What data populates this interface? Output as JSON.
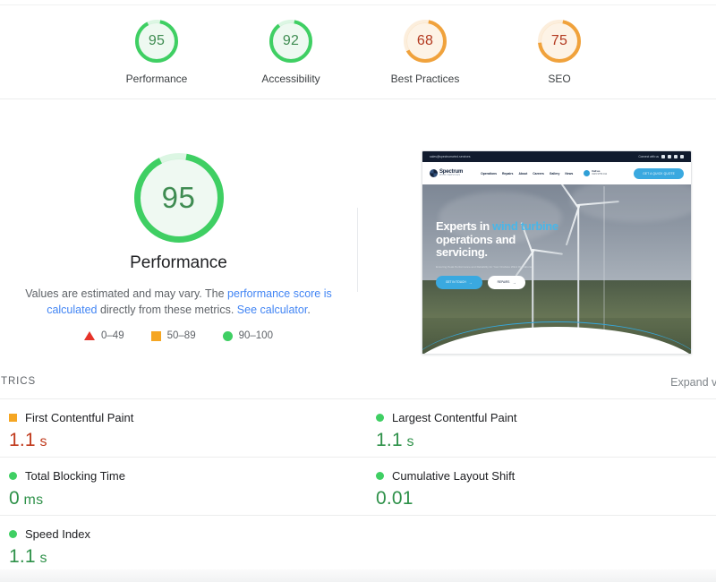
{
  "categories": [
    {
      "label": "Performance",
      "score": 95,
      "ring": "#3fcf63",
      "fill": "#eef9f1",
      "text": "#3f8c52",
      "icon": "gauge-ring-icon"
    },
    {
      "label": "Accessibility",
      "score": 92,
      "ring": "#3fcf63",
      "fill": "#eef9f1",
      "text": "#3f8c52",
      "icon": "gauge-ring-icon"
    },
    {
      "label": "Best Practices",
      "score": 68,
      "ring": "#f0a23c",
      "fill": "#fdf3e6",
      "text": "#b3391f",
      "icon": "gauge-ring-icon"
    },
    {
      "label": "SEO",
      "score": 75,
      "ring": "#f0a23c",
      "fill": "#fdf3e6",
      "text": "#b3391f",
      "icon": "gauge-ring-icon"
    }
  ],
  "hero": {
    "score": 95,
    "ring_color": "#3fcf63",
    "fill_color": "#eff9f2",
    "score_color": "#3f8c52",
    "label": "Performance",
    "disclaimer_prefix": "Values are estimated and may vary. The ",
    "disclaimer_link1": "performance score is calculated",
    "disclaimer_mid": " directly from these metrics. ",
    "disclaimer_link2": "See calculator",
    "disclaimer_suffix": ".",
    "legend": [
      {
        "shape": "triangle",
        "color": "#e63329",
        "range": "0–49"
      },
      {
        "shape": "square",
        "color": "#f5a623",
        "range": "50–89"
      },
      {
        "shape": "circle",
        "color": "#3fcf63",
        "range": "90–100"
      }
    ]
  },
  "screenshot": {
    "topbar": {
      "email": "sales@spectrumwind.services",
      "connect_label": "Connect with us",
      "social_icons": [
        "x-icon",
        "linkedin-icon",
        "instagram-icon",
        "facebook-icon"
      ]
    },
    "brand": {
      "name": "Spectrum",
      "tagline": "WIND SERVICES",
      "logo": "spectrum-logo-icon"
    },
    "nav": [
      "Operations",
      "Repairs",
      "About",
      "Careers",
      "Gallery",
      "News"
    ],
    "phone": {
      "icon": "phone-icon",
      "label": "Call us",
      "number": "0115 9756 011"
    },
    "cta": "GET A QUICK QUOTE",
    "hero": {
      "heading_1": "Experts in ",
      "heading_accent": "wind turbine",
      "heading_2": "operations and",
      "heading_3": "servicing.",
      "subheading": "Ensuring Peak Performance and Reliability for Your Onshore Wind Operations",
      "button_primary": "GET IN TOUCH",
      "button_secondary": "REPAIRS"
    }
  },
  "metrics_section": {
    "title": "METRICS",
    "expand_link": "Expand view",
    "items": [
      {
        "name": "First Contentful Paint",
        "value": "1.1",
        "unit": " s",
        "status": "average",
        "status_shape": "square",
        "status_color": "#f5a623",
        "value_color": "#c0391b"
      },
      {
        "name": "Largest Contentful Paint",
        "value": "1.1",
        "unit": " s",
        "status": "good",
        "status_shape": "circle",
        "status_color": "#3fcf63",
        "value_color": "#2e9149"
      },
      {
        "name": "Total Blocking Time",
        "value": "0",
        "unit": " ms",
        "status": "good",
        "status_shape": "circle",
        "status_color": "#3fcf63",
        "value_color": "#2e9149"
      },
      {
        "name": "Cumulative Layout Shift",
        "value": "0.01",
        "unit": "",
        "status": "good",
        "status_shape": "circle",
        "status_color": "#3fcf63",
        "value_color": "#2e9149"
      },
      {
        "name": "Speed Index",
        "value": "1.1",
        "unit": " s",
        "status": "good",
        "status_shape": "circle",
        "status_color": "#3fcf63",
        "value_color": "#2e9149"
      }
    ]
  }
}
